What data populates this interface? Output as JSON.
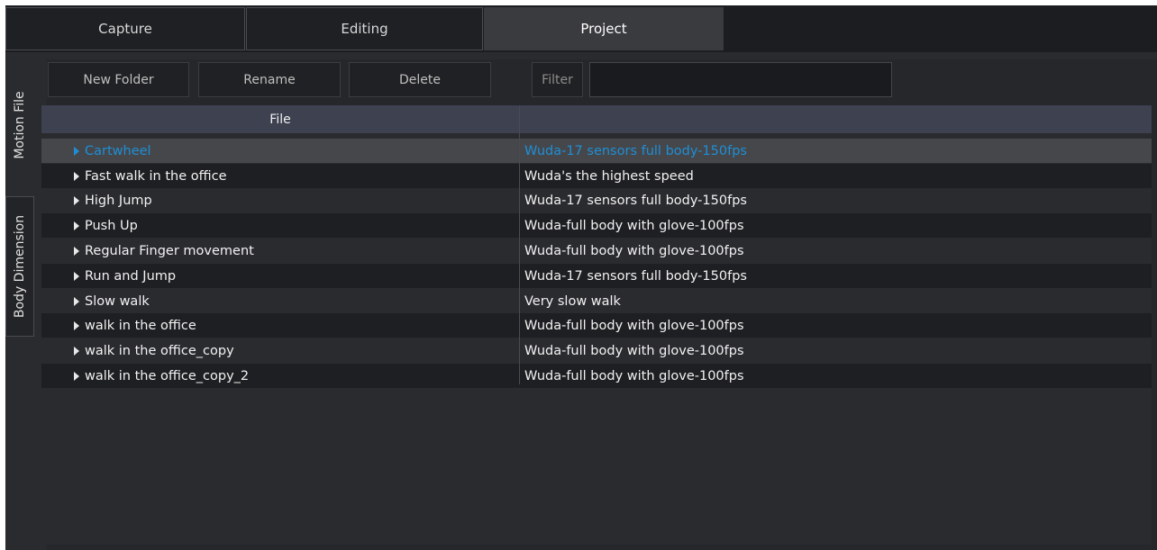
{
  "tabs": [
    {
      "label": "Capture"
    },
    {
      "label": "Editing"
    },
    {
      "label": "Project"
    }
  ],
  "side_tabs": [
    {
      "label": "Motion File"
    },
    {
      "label": "Body Dimension"
    }
  ],
  "toolbar": {
    "new_folder_label": "New Folder",
    "rename_label": "Rename",
    "delete_label": "Delete",
    "filter_label": "Filter",
    "filter_value": ""
  },
  "table": {
    "columns": [
      "File",
      ""
    ],
    "rows": [
      {
        "name": "Cartwheel",
        "desc": "Wuda-17 sensors full body-150fps"
      },
      {
        "name": "Fast walk in the office",
        "desc": "Wuda's the highest speed"
      },
      {
        "name": "High Jump",
        "desc": "Wuda-17 sensors full body-150fps"
      },
      {
        "name": "Push Up",
        "desc": "Wuda-full body with glove-100fps"
      },
      {
        "name": "Regular Finger movement",
        "desc": "Wuda-full body with glove-100fps"
      },
      {
        "name": "Run and Jump",
        "desc": "Wuda-17 sensors full body-150fps"
      },
      {
        "name": "Slow walk",
        "desc": "Very slow walk"
      },
      {
        "name": "walk in the office",
        "desc": "Wuda-full body with glove-100fps"
      },
      {
        "name": "walk in the office_copy",
        "desc": "Wuda-full body with glove-100fps"
      },
      {
        "name": "walk in the office_copy_2",
        "desc": "Wuda-full body with glove-100fps"
      }
    ]
  },
  "colors": {
    "selected_text": "#1e8fd6",
    "header_bg": "#3d4150",
    "window_bg": "#2a2b2f"
  },
  "icons": {
    "row_expander": "triangle-right-icon"
  }
}
